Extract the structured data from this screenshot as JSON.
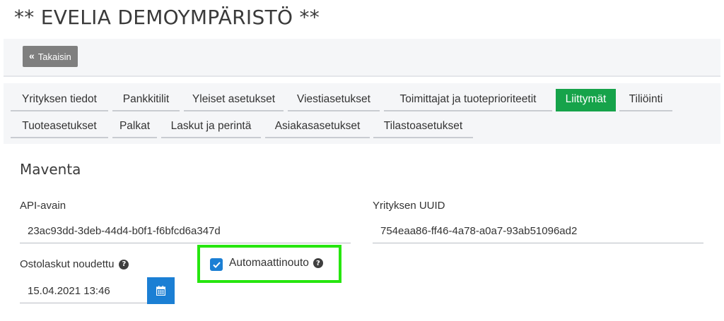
{
  "page": {
    "title": "** EVELIA DEMOYMPÄRISTÖ **"
  },
  "toolbar": {
    "back_label": "Takaisin",
    "back_icon": "double-chevron-left-icon"
  },
  "tabs": [
    {
      "label": "Yrityksen tiedot",
      "active": false
    },
    {
      "label": "Pankkitilit",
      "active": false
    },
    {
      "label": "Yleiset asetukset",
      "active": false
    },
    {
      "label": "Viestiasetukset",
      "active": false
    },
    {
      "label": "Toimittajat ja tuoteprioriteetit",
      "active": false
    },
    {
      "label": "Liittymät",
      "active": true
    },
    {
      "label": "Tiliöinti",
      "active": false
    },
    {
      "label": "Tuoteasetukset",
      "active": false
    },
    {
      "label": "Palkat",
      "active": false
    },
    {
      "label": "Laskut ja perintä",
      "active": false
    },
    {
      "label": "Asiakasasetukset",
      "active": false
    },
    {
      "label": "Tilastoasetukset",
      "active": false
    }
  ],
  "section": {
    "title": "Maventa",
    "api_key": {
      "label": "API-avain",
      "value": "23ac93dd-3deb-44d4-b0f1-f6bfcd6a347d"
    },
    "company_uuid": {
      "label": "Yrityksen UUID",
      "value": "754eaa86-ff46-4a78-a0a7-93ab51096ad2"
    },
    "purchase_invoices_fetched": {
      "label": "Ostolaskut noudettu",
      "value": "15.04.2021 13:46",
      "help_icon": "question-circle-icon"
    },
    "auto_fetch": {
      "label": "Automaattinouto",
      "checked": true,
      "help_icon": "question-circle-icon"
    }
  },
  "colors": {
    "active_tab": "#16a34a",
    "primary": "#1b7fd4",
    "highlight": "#27e60f",
    "back_button": "#7f7f7f"
  }
}
